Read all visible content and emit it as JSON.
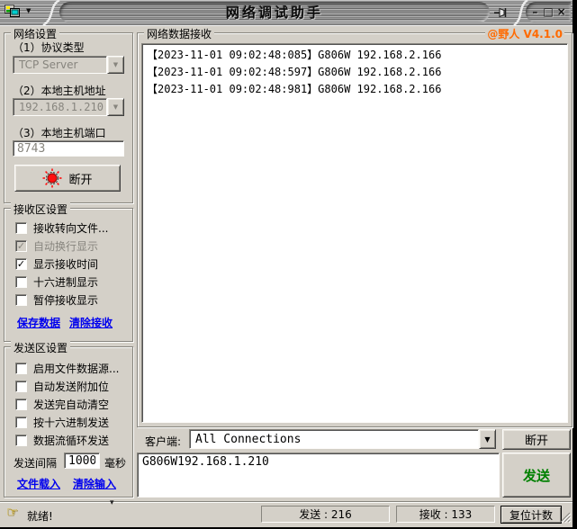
{
  "icons": {
    "menu_arrow": "▼",
    "dropdown_arrow": "▼",
    "check": "✓",
    "minimize": "–",
    "maximize": "□",
    "close": "×",
    "hand": "☞",
    "status_arrow": "▾"
  },
  "window": {
    "title": "网络调试助手"
  },
  "network_settings": {
    "title": "网络设置",
    "protocol_label": "（1）协议类型",
    "protocol_value": "TCP Server",
    "address_label": "（2）本地主机地址",
    "address_value": "192.168.1.210",
    "port_label": "（3）本地主机端口",
    "port_value": "8743",
    "disconnect_button": "断开"
  },
  "receive_settings": {
    "title": "接收区设置",
    "options": [
      {
        "label": "接收转向文件...",
        "checked": false,
        "disabled": false
      },
      {
        "label": "自动换行显示",
        "checked": true,
        "disabled": true
      },
      {
        "label": "显示接收时间",
        "checked": true,
        "disabled": false
      },
      {
        "label": "十六进制显示",
        "checked": false,
        "disabled": false
      },
      {
        "label": "暂停接收显示",
        "checked": false,
        "disabled": false
      }
    ],
    "save_link": "保存数据",
    "clear_link": "清除接收"
  },
  "send_settings": {
    "title": "发送区设置",
    "options": [
      {
        "label": "启用文件数据源...",
        "checked": false,
        "disabled": false
      },
      {
        "label": "自动发送附加位",
        "checked": false,
        "disabled": false
      },
      {
        "label": "发送完自动清空",
        "checked": false,
        "disabled": false
      },
      {
        "label": "按十六进制发送",
        "checked": false,
        "disabled": false
      },
      {
        "label": "数据流循环发送",
        "checked": false,
        "disabled": false
      }
    ],
    "interval_label": "发送间隔",
    "interval_value": "1000",
    "interval_unit": "毫秒",
    "load_link": "文件载入",
    "clear_link": "清除输入"
  },
  "receive_panel": {
    "title": "网络数据接收",
    "version": "@野人 V4.1.0",
    "log": [
      "【2023-11-01 09:02:48:085】G806W 192.168.2.166",
      "【2023-11-01 09:02:48:597】G806W 192.168.2.166",
      "【2023-11-01 09:02:48:981】G806W 192.168.2.166"
    ]
  },
  "client_bar": {
    "label": "客户端:",
    "selected": "All Connections",
    "disconnect_button": "断开"
  },
  "send_bar": {
    "input_value": "G806W192.168.1.210",
    "send_button": "发送"
  },
  "status_bar": {
    "status": "就绪!",
    "sent_text": "发送 : 216",
    "received_text": "接收 : 133",
    "reset_button": "复位计数"
  },
  "colors": {
    "accent_orange": "#ff6a00",
    "link_blue": "#0000ee",
    "send_green": "#008000",
    "led_red": "#ff1010"
  }
}
